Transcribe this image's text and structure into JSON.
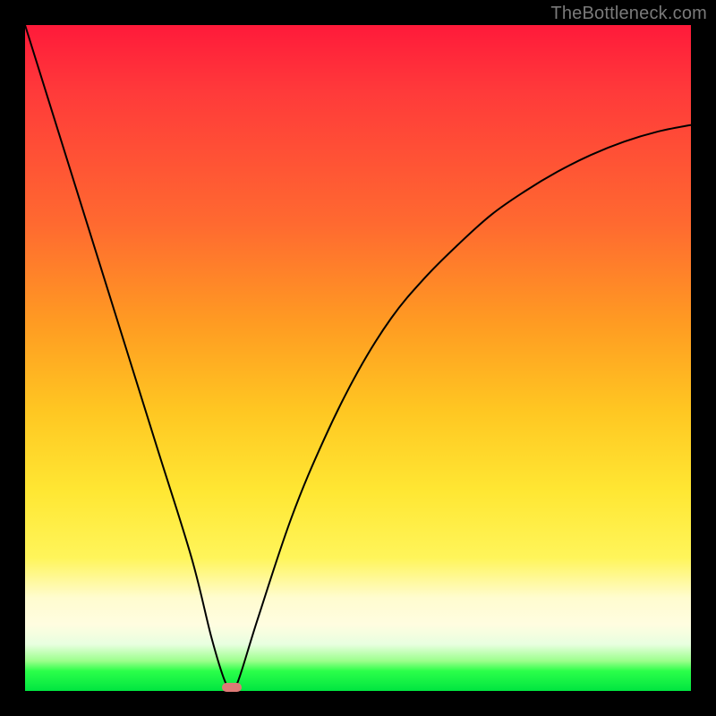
{
  "watermark": "TheBottleneck.com",
  "colors": {
    "frame": "#000000",
    "curve": "#000000",
    "marker": "#de7a76",
    "gradient_stops": [
      "#ff1a3a",
      "#ff3a3a",
      "#ff6a30",
      "#ff9c22",
      "#ffc722",
      "#ffe733",
      "#fff55a",
      "#fffccf",
      "#fffde0",
      "#e8ffe0",
      "#9cff8c",
      "#2cff4a",
      "#00e540"
    ]
  },
  "chart_data": {
    "type": "line",
    "title": "",
    "xlabel": "",
    "ylabel": "",
    "xlim": [
      0,
      100
    ],
    "ylim": [
      0,
      100
    ],
    "grid": false,
    "legend": false,
    "series": [
      {
        "name": "bottleneck-curve",
        "x": [
          0,
          5,
          10,
          15,
          20,
          25,
          28,
          30,
          31,
          32,
          35,
          40,
          45,
          50,
          55,
          60,
          65,
          70,
          75,
          80,
          85,
          90,
          95,
          100
        ],
        "y": [
          100,
          84,
          68,
          52,
          36,
          20,
          8,
          1.5,
          0.5,
          1.5,
          11,
          26,
          38,
          48,
          56,
          62,
          67,
          71.5,
          75,
          78,
          80.5,
          82.5,
          84,
          85
        ]
      }
    ],
    "annotations": [
      {
        "name": "optimum-marker",
        "x": 31,
        "y": 0.5
      }
    ],
    "notes": "No axis tick labels or numeric annotations are visible; y-values estimated from curve shape against gradient (0 at bottom/green, 100 at top/red)."
  }
}
